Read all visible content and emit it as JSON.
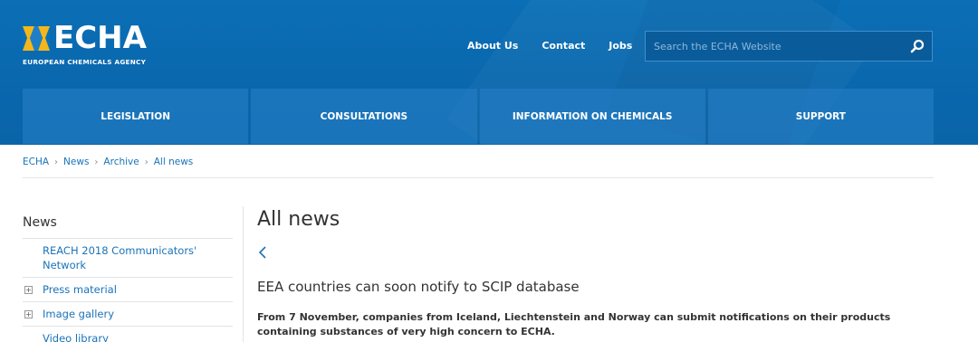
{
  "brand": {
    "name": "ECHA",
    "subtitle": "EUROPEAN CHEMICALS AGENCY"
  },
  "top_links": [
    {
      "label": "About Us"
    },
    {
      "label": "Contact"
    },
    {
      "label": "Jobs"
    }
  ],
  "search": {
    "placeholder": "Search the ECHA Website",
    "icon": "search-icon"
  },
  "nav": [
    {
      "label": "LEGISLATION"
    },
    {
      "label": "CONSULTATIONS"
    },
    {
      "label": "INFORMATION ON CHEMICALS"
    },
    {
      "label": "SUPPORT"
    }
  ],
  "breadcrumb": [
    "ECHA",
    "News",
    "Archive",
    "All news"
  ],
  "sidebar": {
    "title": "News",
    "items": [
      {
        "label": "REACH 2018 Communicators' Network",
        "expandable": false
      },
      {
        "label": "Press material",
        "expandable": true
      },
      {
        "label": "Image gallery",
        "expandable": true
      },
      {
        "label": "Video library",
        "expandable": false
      }
    ]
  },
  "main": {
    "title": "All news",
    "back_icon": "chevron-left-icon",
    "news_title": "EEA countries can soon notify to SCIP database",
    "news_summary": "From 7 November, companies from Iceland, Liechtenstein and Norway  can submit notifications on their products containing substances of very high concern to ECHA."
  },
  "colors": {
    "header_blue": "#0b6fb6",
    "link_blue": "#1a73b8",
    "logo_yellow": "#f4b71a"
  }
}
